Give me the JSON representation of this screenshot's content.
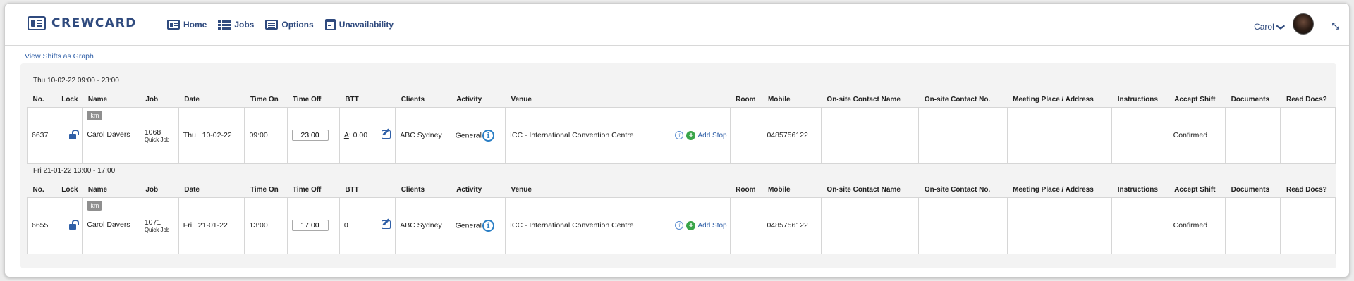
{
  "app": {
    "brand": "CREWCARD"
  },
  "nav": [
    {
      "label": "Home",
      "icon": "home-card-icon"
    },
    {
      "label": "Jobs",
      "icon": "list-icon"
    },
    {
      "label": "Options",
      "icon": "options-icon"
    },
    {
      "label": "Unavailability",
      "icon": "calendar-icon"
    }
  ],
  "user": {
    "name": "Carol",
    "chevron": "❯"
  },
  "collapse_glyph": "⤡",
  "links": {
    "graph": "View Shifts as Graph"
  },
  "columns": [
    "No.",
    "Lock",
    "Name",
    "Job",
    "Date",
    "Time On",
    "Time Off",
    "BTT",
    "",
    "Clients",
    "Activity",
    "Venue",
    "Room",
    "Mobile",
    "On-site Contact Name",
    "On-site Contact No.",
    "Meeting Place / Address",
    "Instructions",
    "Accept Shift",
    "Documents",
    "Read Docs?"
  ],
  "groups": [
    {
      "title": "Thu 10-02-22 09:00 - 23:00",
      "row": {
        "no": "6637",
        "badge": "km",
        "name": "Carol Davers",
        "job_no": "1068",
        "job_type": "Quick Job",
        "date": "Thu   10-02-22",
        "time_on": "09:00",
        "time_off": "23:00",
        "btt_prefix": "A",
        "btt_value": ": 0.00",
        "client": "ABC Sydney",
        "activity": "General",
        "venue": "ICC - International Convention Centre",
        "add_stop": "Add Stop",
        "room": "",
        "mobile": "0485756122",
        "contact_name": "",
        "contact_no": "",
        "meeting_place": "",
        "instructions": "",
        "accept_shift": "Confirmed",
        "documents": "",
        "read_docs": ""
      }
    },
    {
      "title": "Fri 21-01-22 13:00 - 17:00",
      "row": {
        "no": "6655",
        "badge": "km",
        "name": "Carol Davers",
        "job_no": "1071",
        "job_type": "Quick Job",
        "date": "Fri   21-01-22",
        "time_on": "13:00",
        "time_off": "17:00",
        "btt_prefix": "",
        "btt_value": "0",
        "client": "ABC Sydney",
        "activity": "General",
        "venue": "ICC - International Convention Centre",
        "add_stop": "Add Stop",
        "room": "",
        "mobile": "0485756122",
        "contact_name": "",
        "contact_no": "",
        "meeting_place": "",
        "instructions": "",
        "accept_shift": "Confirmed",
        "documents": "",
        "read_docs": ""
      }
    }
  ]
}
